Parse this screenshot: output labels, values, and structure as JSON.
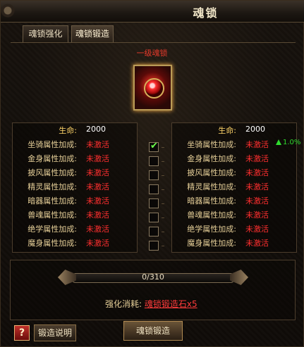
{
  "window": {
    "title": "魂锁"
  },
  "tabs": [
    {
      "label": "魂锁强化",
      "active": false
    },
    {
      "label": "魂锁锻造",
      "active": true
    }
  ],
  "gem": {
    "level_text": "一级魂锁"
  },
  "left_panel": {
    "hp_label": "生命:",
    "hp_value": "2000",
    "rows": [
      {
        "label": "坐骑属性加成:",
        "value": "未激活"
      },
      {
        "label": "金身属性加成:",
        "value": "未激活"
      },
      {
        "label": "披风属性加成:",
        "value": "未激活"
      },
      {
        "label": "精灵属性加成:",
        "value": "未激活"
      },
      {
        "label": "暗器属性加成:",
        "value": "未激活"
      },
      {
        "label": "兽魂属性加成:",
        "value": "未激活"
      },
      {
        "label": "绝学属性加成:",
        "value": "未激活"
      },
      {
        "label": "魔身属性加成:",
        "value": "未激活"
      }
    ]
  },
  "right_panel": {
    "hp_label": "生命:",
    "hp_value": "2000",
    "rows": [
      {
        "label": "坐骑属性加成:",
        "value": "未激活",
        "delta": "1.0%"
      },
      {
        "label": "金身属性加成:",
        "value": "未激活"
      },
      {
        "label": "披风属性加成:",
        "value": "未激活"
      },
      {
        "label": "精灵属性加成:",
        "value": "未激活"
      },
      {
        "label": "暗器属性加成:",
        "value": "未激活"
      },
      {
        "label": "兽魂属性加成:",
        "value": "未激活"
      },
      {
        "label": "绝学属性加成:",
        "value": "未激活"
      },
      {
        "label": "魔身属性加成:",
        "value": "未激活"
      }
    ]
  },
  "checkboxes": [
    true,
    false,
    false,
    false,
    false,
    false,
    false,
    false
  ],
  "progress": {
    "text": "0/310",
    "current": 0,
    "max": 310
  },
  "cost": {
    "label": "强化消耗:",
    "item": "魂锁锻造石x5"
  },
  "buttons": {
    "help": "?",
    "explain": "锻造说明",
    "forge": "魂锁锻造"
  },
  "colors": {
    "accent_gold": "#e6cf98",
    "inactive_red": "#ff2f2f",
    "bonus_green": "#2fdc2f"
  },
  "icons": {
    "up": "green-up-arrow-icon",
    "check": "checkmark-icon"
  }
}
